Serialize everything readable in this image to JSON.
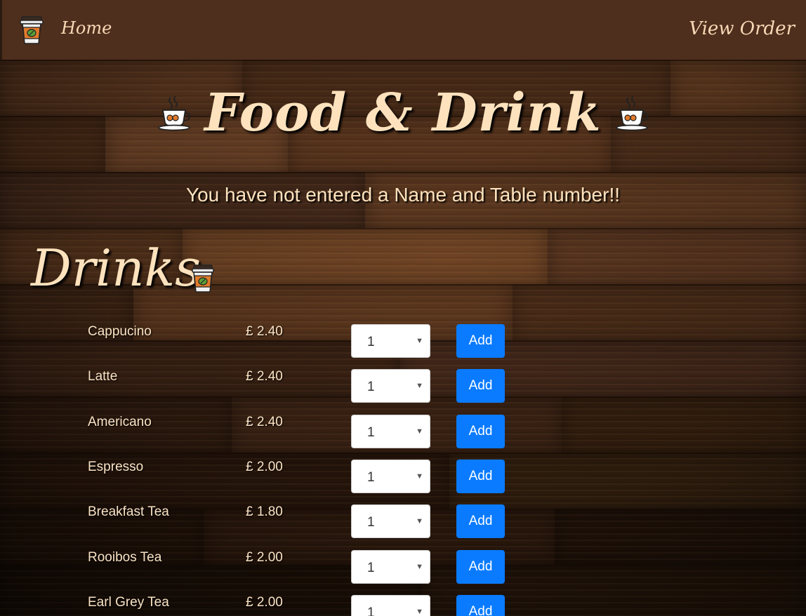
{
  "navbar": {
    "logo_icon": "coffee-cup-icon",
    "home_label": "Home",
    "view_order_label": "View Order"
  },
  "header": {
    "title": "Food & Drink",
    "title_icon": "coffee-saucer-icon",
    "warning": "You have not entered a Name and Table number!!"
  },
  "drinks": {
    "section_title": "Drinks",
    "section_icon": "takeaway-cup-icon",
    "add_label": "Add",
    "items": [
      {
        "name": "Cappucino",
        "price": "£ 2.40",
        "qty": "1"
      },
      {
        "name": "Latte",
        "price": "£ 2.40",
        "qty": "1"
      },
      {
        "name": "Americano",
        "price": "£ 2.40",
        "qty": "1"
      },
      {
        "name": "Espresso",
        "price": "£ 2.00",
        "qty": "1"
      },
      {
        "name": "Breakfast Tea",
        "price": "£ 1.80",
        "qty": "1"
      },
      {
        "name": "Rooibos Tea",
        "price": "£ 2.00",
        "qty": "1"
      },
      {
        "name": "Earl Grey Tea",
        "price": "£ 2.00",
        "qty": "1"
      }
    ]
  },
  "colors": {
    "navbar_bg": "#4e2e1c",
    "accent_text": "#fde2bd",
    "button_blue": "#0a7bff"
  }
}
